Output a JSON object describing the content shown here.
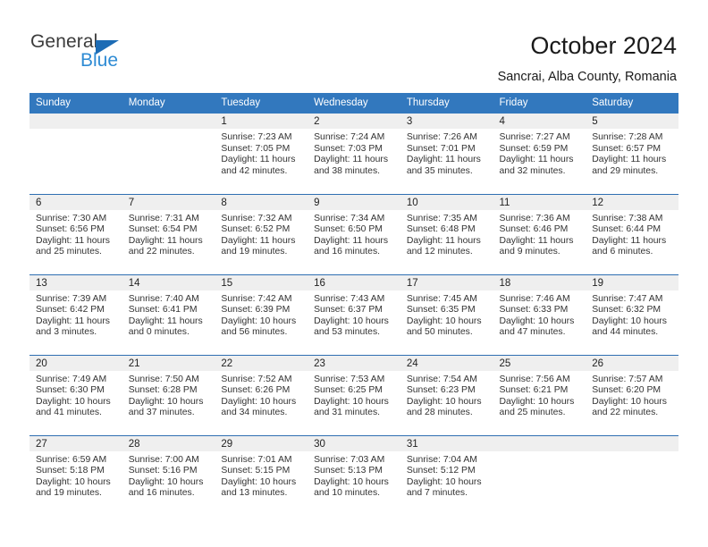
{
  "brand": {
    "name_part1": "General",
    "name_part2": "Blue",
    "accent_color": "#1d6cb5",
    "secondary_color": "#2e8bd4",
    "triangle_icon": "triangle-icon"
  },
  "header": {
    "title": "October 2024",
    "subtitle": "Sancrai, Alba County, Romania"
  },
  "calendar": {
    "header_color": "#3278be",
    "daynum_band_color": "#efefef",
    "weekday_headers": [
      "Sunday",
      "Monday",
      "Tuesday",
      "Wednesday",
      "Thursday",
      "Friday",
      "Saturday"
    ],
    "weeks": [
      [
        {
          "day": "",
          "lines": []
        },
        {
          "day": "",
          "lines": []
        },
        {
          "day": "1",
          "lines": [
            "Sunrise: 7:23 AM",
            "Sunset: 7:05 PM",
            "Daylight: 11 hours",
            "and 42 minutes."
          ]
        },
        {
          "day": "2",
          "lines": [
            "Sunrise: 7:24 AM",
            "Sunset: 7:03 PM",
            "Daylight: 11 hours",
            "and 38 minutes."
          ]
        },
        {
          "day": "3",
          "lines": [
            "Sunrise: 7:26 AM",
            "Sunset: 7:01 PM",
            "Daylight: 11 hours",
            "and 35 minutes."
          ]
        },
        {
          "day": "4",
          "lines": [
            "Sunrise: 7:27 AM",
            "Sunset: 6:59 PM",
            "Daylight: 11 hours",
            "and 32 minutes."
          ]
        },
        {
          "day": "5",
          "lines": [
            "Sunrise: 7:28 AM",
            "Sunset: 6:57 PM",
            "Daylight: 11 hours",
            "and 29 minutes."
          ]
        }
      ],
      [
        {
          "day": "6",
          "lines": [
            "Sunrise: 7:30 AM",
            "Sunset: 6:56 PM",
            "Daylight: 11 hours",
            "and 25 minutes."
          ]
        },
        {
          "day": "7",
          "lines": [
            "Sunrise: 7:31 AM",
            "Sunset: 6:54 PM",
            "Daylight: 11 hours",
            "and 22 minutes."
          ]
        },
        {
          "day": "8",
          "lines": [
            "Sunrise: 7:32 AM",
            "Sunset: 6:52 PM",
            "Daylight: 11 hours",
            "and 19 minutes."
          ]
        },
        {
          "day": "9",
          "lines": [
            "Sunrise: 7:34 AM",
            "Sunset: 6:50 PM",
            "Daylight: 11 hours",
            "and 16 minutes."
          ]
        },
        {
          "day": "10",
          "lines": [
            "Sunrise: 7:35 AM",
            "Sunset: 6:48 PM",
            "Daylight: 11 hours",
            "and 12 minutes."
          ]
        },
        {
          "day": "11",
          "lines": [
            "Sunrise: 7:36 AM",
            "Sunset: 6:46 PM",
            "Daylight: 11 hours",
            "and 9 minutes."
          ]
        },
        {
          "day": "12",
          "lines": [
            "Sunrise: 7:38 AM",
            "Sunset: 6:44 PM",
            "Daylight: 11 hours",
            "and 6 minutes."
          ]
        }
      ],
      [
        {
          "day": "13",
          "lines": [
            "Sunrise: 7:39 AM",
            "Sunset: 6:42 PM",
            "Daylight: 11 hours",
            "and 3 minutes."
          ]
        },
        {
          "day": "14",
          "lines": [
            "Sunrise: 7:40 AM",
            "Sunset: 6:41 PM",
            "Daylight: 11 hours",
            "and 0 minutes."
          ]
        },
        {
          "day": "15",
          "lines": [
            "Sunrise: 7:42 AM",
            "Sunset: 6:39 PM",
            "Daylight: 10 hours",
            "and 56 minutes."
          ]
        },
        {
          "day": "16",
          "lines": [
            "Sunrise: 7:43 AM",
            "Sunset: 6:37 PM",
            "Daylight: 10 hours",
            "and 53 minutes."
          ]
        },
        {
          "day": "17",
          "lines": [
            "Sunrise: 7:45 AM",
            "Sunset: 6:35 PM",
            "Daylight: 10 hours",
            "and 50 minutes."
          ]
        },
        {
          "day": "18",
          "lines": [
            "Sunrise: 7:46 AM",
            "Sunset: 6:33 PM",
            "Daylight: 10 hours",
            "and 47 minutes."
          ]
        },
        {
          "day": "19",
          "lines": [
            "Sunrise: 7:47 AM",
            "Sunset: 6:32 PM",
            "Daylight: 10 hours",
            "and 44 minutes."
          ]
        }
      ],
      [
        {
          "day": "20",
          "lines": [
            "Sunrise: 7:49 AM",
            "Sunset: 6:30 PM",
            "Daylight: 10 hours",
            "and 41 minutes."
          ]
        },
        {
          "day": "21",
          "lines": [
            "Sunrise: 7:50 AM",
            "Sunset: 6:28 PM",
            "Daylight: 10 hours",
            "and 37 minutes."
          ]
        },
        {
          "day": "22",
          "lines": [
            "Sunrise: 7:52 AM",
            "Sunset: 6:26 PM",
            "Daylight: 10 hours",
            "and 34 minutes."
          ]
        },
        {
          "day": "23",
          "lines": [
            "Sunrise: 7:53 AM",
            "Sunset: 6:25 PM",
            "Daylight: 10 hours",
            "and 31 minutes."
          ]
        },
        {
          "day": "24",
          "lines": [
            "Sunrise: 7:54 AM",
            "Sunset: 6:23 PM",
            "Daylight: 10 hours",
            "and 28 minutes."
          ]
        },
        {
          "day": "25",
          "lines": [
            "Sunrise: 7:56 AM",
            "Sunset: 6:21 PM",
            "Daylight: 10 hours",
            "and 25 minutes."
          ]
        },
        {
          "day": "26",
          "lines": [
            "Sunrise: 7:57 AM",
            "Sunset: 6:20 PM",
            "Daylight: 10 hours",
            "and 22 minutes."
          ]
        }
      ],
      [
        {
          "day": "27",
          "lines": [
            "Sunrise: 6:59 AM",
            "Sunset: 5:18 PM",
            "Daylight: 10 hours",
            "and 19 minutes."
          ]
        },
        {
          "day": "28",
          "lines": [
            "Sunrise: 7:00 AM",
            "Sunset: 5:16 PM",
            "Daylight: 10 hours",
            "and 16 minutes."
          ]
        },
        {
          "day": "29",
          "lines": [
            "Sunrise: 7:01 AM",
            "Sunset: 5:15 PM",
            "Daylight: 10 hours",
            "and 13 minutes."
          ]
        },
        {
          "day": "30",
          "lines": [
            "Sunrise: 7:03 AM",
            "Sunset: 5:13 PM",
            "Daylight: 10 hours",
            "and 10 minutes."
          ]
        },
        {
          "day": "31",
          "lines": [
            "Sunrise: 7:04 AM",
            "Sunset: 5:12 PM",
            "Daylight: 10 hours",
            "and 7 minutes."
          ]
        },
        {
          "day": "",
          "lines": []
        },
        {
          "day": "",
          "lines": []
        }
      ]
    ]
  }
}
